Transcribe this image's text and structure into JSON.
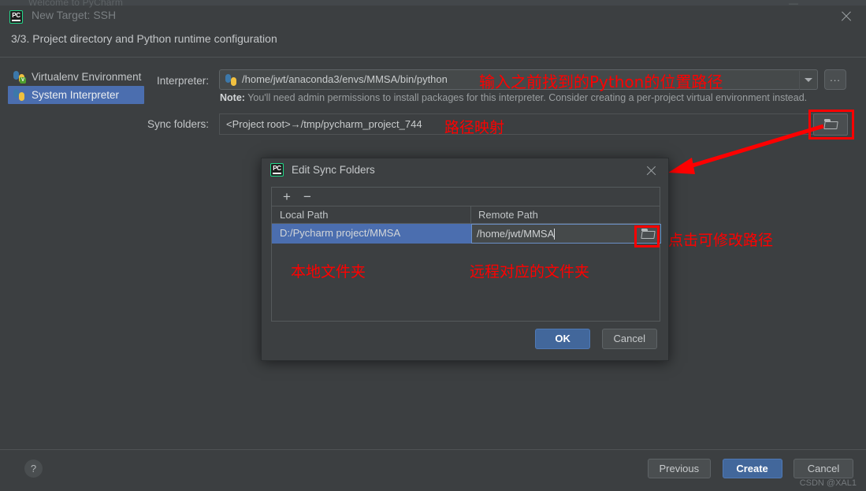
{
  "back_window": {
    "title": "Welcome to PyCharm",
    "minimize_icon": "minimize-icon"
  },
  "window": {
    "title": "New Target: SSH",
    "logo_text": "PC",
    "close_icon": "close-icon",
    "step_title": "3/3. Project directory and Python runtime configuration"
  },
  "env_list": [
    {
      "label": "Virtualenv Environment",
      "selected": false,
      "icon": "python-venv-icon"
    },
    {
      "label": "System Interpreter",
      "selected": true,
      "icon": "python-icon"
    }
  ],
  "form": {
    "interpreter_label": "Interpreter:",
    "interpreter_value": "/home/jwt/anaconda3/envs/MMSA/bin/python",
    "interpreter_dropdown_icon": "chevron-down-icon",
    "ellipsis_button_label": "...",
    "note_prefix": "Note:",
    "note_text": " You'll need admin permissions to install packages for this interpreter. Consider creating a per-project virtual environment instead.",
    "sync_label": "Sync folders:",
    "sync_value": "<Project root>→/tmp/pycharm_project_744",
    "sync_browse_icon": "folder-icon"
  },
  "annotations": {
    "interpreter_note": "输入之前找到的Python的位置路径",
    "sync_note": "路径映射",
    "local_note": "本地文件夹",
    "remote_note": "远程对应的文件夹",
    "click_note": "点击可修改路径",
    "color": "#ff0000"
  },
  "modal": {
    "title": "Edit Sync Folders",
    "logo_text": "PC",
    "close_icon": "close-icon",
    "toolbar": {
      "add_label": "+",
      "remove_label": "−"
    },
    "table": {
      "columns": [
        "Local Path",
        "Remote Path"
      ],
      "rows": [
        {
          "local": "D:/Pycharm project/MMSA",
          "remote": "/home/jwt/MMSA",
          "selected": true,
          "browse_icon": "folder-icon"
        }
      ]
    },
    "ok_label": "OK",
    "cancel_label": "Cancel"
  },
  "footer": {
    "help_label": "?",
    "previous_label": "Previous",
    "create_label": "Create",
    "cancel_label": "Cancel"
  },
  "watermark": "CSDN @XAL1",
  "colors": {
    "background": "#3c3f41",
    "selection": "#4b6eaf",
    "accent_button": "#42679b",
    "annotation_red": "#ff0000",
    "logo_green": "#21d789"
  }
}
